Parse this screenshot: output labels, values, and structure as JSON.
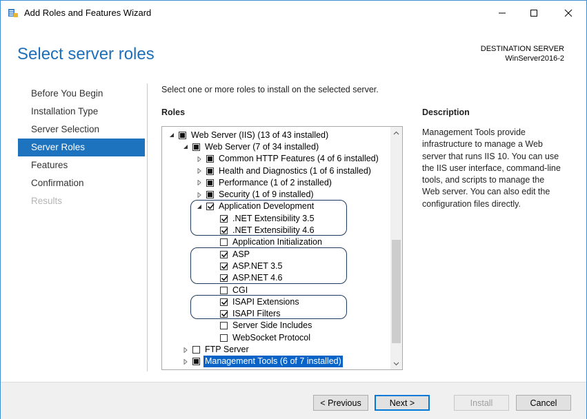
{
  "window": {
    "title": "Add Roles and Features Wizard"
  },
  "header": {
    "page_title": "Select server roles",
    "destination_label": "DESTINATION SERVER",
    "destination_server": "WinServer2016-2"
  },
  "nav": {
    "items": [
      {
        "label": "Before You Begin",
        "state": "normal"
      },
      {
        "label": "Installation Type",
        "state": "normal"
      },
      {
        "label": "Server Selection",
        "state": "normal"
      },
      {
        "label": "Server Roles",
        "state": "active"
      },
      {
        "label": "Features",
        "state": "normal"
      },
      {
        "label": "Confirmation",
        "state": "normal"
      },
      {
        "label": "Results",
        "state": "disabled"
      }
    ]
  },
  "content": {
    "instruction": "Select one or more roles to install on the selected server.",
    "roles_label": "Roles",
    "description_label": "Description",
    "description_text": "Management Tools provide infrastructure to manage a Web server that runs IIS 10. You can use the IIS user interface, command-line tools, and scripts to manage the Web server. You can also edit the configuration files directly."
  },
  "tree": {
    "rows": [
      {
        "label": "Web Server (IIS) (13 of 43 installed)",
        "expander": "expanded",
        "check": "partial"
      },
      {
        "label": "Web Server (7 of 34 installed)",
        "expander": "expanded",
        "check": "partial"
      },
      {
        "label": "Common HTTP Features (4 of 6 installed)",
        "expander": "collapsed",
        "check": "partial"
      },
      {
        "label": "Health and Diagnostics (1 of 6 installed)",
        "expander": "collapsed",
        "check": "partial"
      },
      {
        "label": "Performance (1 of 2 installed)",
        "expander": "collapsed",
        "check": "partial"
      },
      {
        "label": "Security (1 of 9 installed)",
        "expander": "collapsed",
        "check": "partial"
      },
      {
        "label": "Application Development",
        "expander": "expanded",
        "check": "checked"
      },
      {
        "label": ".NET Extensibility 3.5",
        "expander": "none",
        "check": "checked"
      },
      {
        "label": ".NET Extensibility 4.6",
        "expander": "none",
        "check": "checked"
      },
      {
        "label": "Application Initialization",
        "expander": "none",
        "check": "unchecked"
      },
      {
        "label": "ASP",
        "expander": "none",
        "check": "checked"
      },
      {
        "label": "ASP.NET 3.5",
        "expander": "none",
        "check": "checked"
      },
      {
        "label": "ASP.NET 4.6",
        "expander": "none",
        "check": "checked"
      },
      {
        "label": "CGI",
        "expander": "none",
        "check": "unchecked"
      },
      {
        "label": "ISAPI Extensions",
        "expander": "none",
        "check": "checked"
      },
      {
        "label": "ISAPI Filters",
        "expander": "none",
        "check": "checked"
      },
      {
        "label": "Server Side Includes",
        "expander": "none",
        "check": "unchecked"
      },
      {
        "label": "WebSocket Protocol",
        "expander": "none",
        "check": "unchecked"
      },
      {
        "label": "FTP Server",
        "expander": "collapsed",
        "check": "unchecked"
      },
      {
        "label": "Management Tools (6 of 7 installed)",
        "expander": "collapsed",
        "check": "partial",
        "selected": true
      }
    ]
  },
  "buttons": {
    "previous": "< Previous",
    "next": "Next >",
    "install": "Install",
    "cancel": "Cancel"
  },
  "colors": {
    "accent": "#1e73be",
    "title": "#1e6fb9",
    "selection": "#0a64c8",
    "highlight_border": "#1f3b5c"
  }
}
